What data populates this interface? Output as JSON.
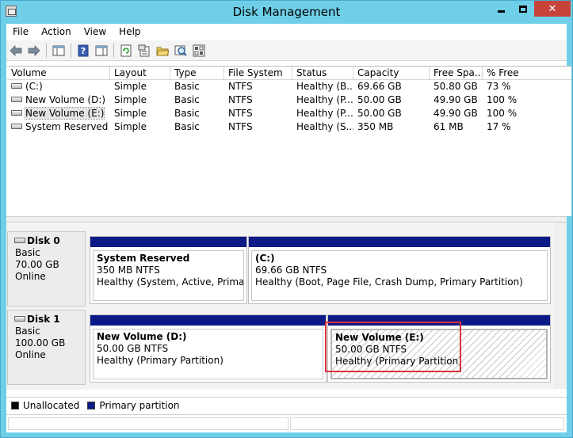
{
  "window": {
    "title": "Disk Management",
    "accent": "#6fcfe8",
    "close_color": "#c7433a"
  },
  "menu": [
    "File",
    "Action",
    "View",
    "Help"
  ],
  "toolbar": {
    "icons": [
      "back-arrow-icon",
      "forward-arrow-icon",
      "console-tree-icon",
      "help-icon",
      "properties-pane-icon",
      "refresh-icon",
      "properties-icon",
      "open-folder-icon",
      "rescan-disks-icon",
      "settings-icon"
    ]
  },
  "volume_list": {
    "columns": [
      "Volume",
      "Layout",
      "Type",
      "File System",
      "Status",
      "Capacity",
      "Free Spa...",
      "% Free"
    ],
    "rows": [
      {
        "volume": "(C:)",
        "layout": "Simple",
        "type": "Basic",
        "fs": "NTFS",
        "status": "Healthy (B...",
        "capacity": "69.66 GB",
        "free": "50.80 GB",
        "pct": "73 %"
      },
      {
        "volume": "New Volume (D:)",
        "layout": "Simple",
        "type": "Basic",
        "fs": "NTFS",
        "status": "Healthy (P...",
        "capacity": "50.00 GB",
        "free": "49.90 GB",
        "pct": "100 %"
      },
      {
        "volume": "New Volume (E:)",
        "layout": "Simple",
        "type": "Basic",
        "fs": "NTFS",
        "status": "Healthy (P...",
        "capacity": "50.00 GB",
        "free": "49.90 GB",
        "pct": "100 %"
      },
      {
        "volume": "System Reserved",
        "layout": "Simple",
        "type": "Basic",
        "fs": "NTFS",
        "status": "Healthy (S...",
        "capacity": "350 MB",
        "free": "61 MB",
        "pct": "17 %"
      }
    ]
  },
  "disks": [
    {
      "name": "Disk 0",
      "kind": "Basic",
      "size": "70.00 GB",
      "state": "Online",
      "partitions": [
        {
          "name": "System Reserved",
          "size": "350 MB NTFS",
          "status": "Healthy (System, Active, Primary Pa"
        },
        {
          "name": "(C:)",
          "size": "69.66 GB NTFS",
          "status": "Healthy (Boot, Page File, Crash Dump, Primary Partition)"
        }
      ]
    },
    {
      "name": "Disk 1",
      "kind": "Basic",
      "size": "100.00 GB",
      "state": "Online",
      "partitions": [
        {
          "name": "New Volume  (D:)",
          "size": "50.00 GB NTFS",
          "status": "Healthy (Primary Partition)"
        },
        {
          "name": "New Volume  (E:)",
          "size": "50.00 GB NTFS",
          "status": "Healthy (Primary Partition)"
        }
      ]
    }
  ],
  "legend": [
    {
      "label": "Unallocated",
      "color": "#000000"
    },
    {
      "label": "Primary partition",
      "color": "#0b1a86"
    }
  ],
  "colors": {
    "primary_partition": "#0b1a86",
    "highlight_box": "#d9313c"
  }
}
